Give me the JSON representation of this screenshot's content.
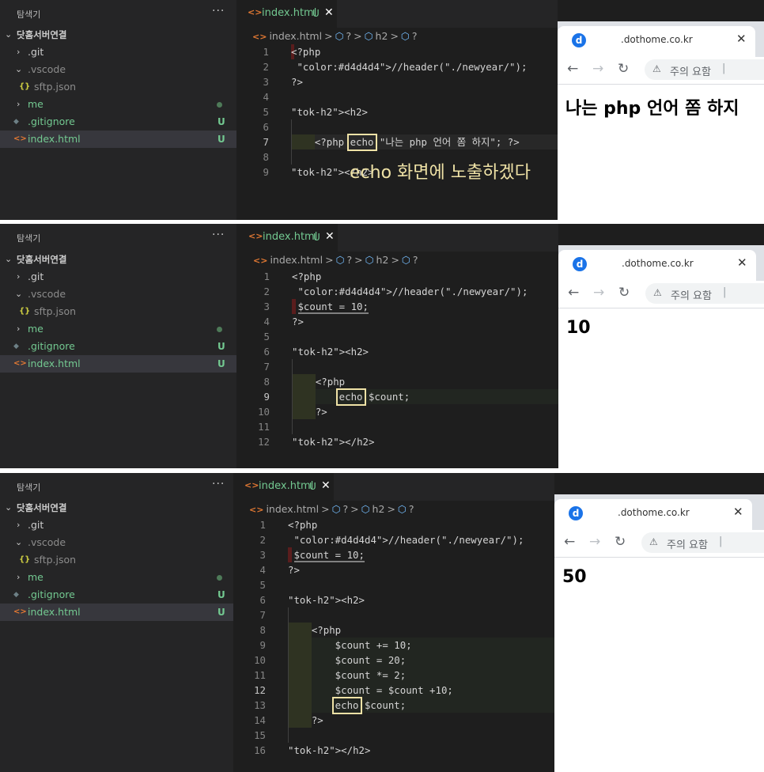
{
  "sidebar": {
    "title": "탐색기",
    "more": "···",
    "root": "닷홈서버연결",
    "items": [
      {
        "label": ".git"
      },
      {
        "label": ".vscode"
      },
      {
        "label": "sftp.json"
      },
      {
        "label": "me"
      },
      {
        "label": ".gitignore",
        "badge": "U"
      },
      {
        "label": "index.html",
        "badge": "U"
      }
    ]
  },
  "tab": {
    "icon": "<>",
    "name": "index.html",
    "status": "U",
    "close": "✕"
  },
  "breadcrumb": {
    "file": "index.html",
    "sep": ">",
    "s1": "?",
    "s2": "h2",
    "s3": "?"
  },
  "browser": {
    "favicon": "d",
    "tab_title": ".dothome.co.kr",
    "tab_close": "✕",
    "warning_icon": "⚠",
    "warning_text": "주의 요함",
    "pipe": "|",
    "back": "←",
    "forward": "→",
    "reload": "↻"
  },
  "panels": [
    {
      "lines": [
        {
          "n": "1",
          "text": "<?php"
        },
        {
          "n": "2",
          "text": " //header(\"./newyear/\");"
        },
        {
          "n": "3",
          "text": "?>"
        },
        {
          "n": "4",
          "text": ""
        },
        {
          "n": "5",
          "text": "<h2>"
        },
        {
          "n": "6",
          "text": ""
        },
        {
          "n": "7",
          "text": "    <?php echo \"나는 php 언어 쫌 하지\"; ?>"
        },
        {
          "n": "8",
          "text": ""
        },
        {
          "n": "9",
          "text": "</h2>"
        }
      ],
      "annotation": "echo 화면에 노출하겠다",
      "output": "나는 php 언어 쫌 하지"
    },
    {
      "lines": [
        {
          "n": "1",
          "text": "<?php"
        },
        {
          "n": "2",
          "text": " //header(\"./newyear/\");"
        },
        {
          "n": "3",
          "text": " $count = 10;"
        },
        {
          "n": "4",
          "text": "?>"
        },
        {
          "n": "5",
          "text": ""
        },
        {
          "n": "6",
          "text": "<h2>"
        },
        {
          "n": "7",
          "text": ""
        },
        {
          "n": "8",
          "text": "    <?php"
        },
        {
          "n": "9",
          "text": "        echo $count;"
        },
        {
          "n": "10",
          "text": "    ?>"
        },
        {
          "n": "11",
          "text": ""
        },
        {
          "n": "12",
          "text": "</h2>"
        }
      ],
      "output": "10"
    },
    {
      "lines": [
        {
          "n": "1",
          "text": "<?php"
        },
        {
          "n": "2",
          "text": " //header(\"./newyear/\");"
        },
        {
          "n": "3",
          "text": " $count = 10;"
        },
        {
          "n": "4",
          "text": "?>"
        },
        {
          "n": "5",
          "text": ""
        },
        {
          "n": "6",
          "text": "<h2>"
        },
        {
          "n": "7",
          "text": ""
        },
        {
          "n": "8",
          "text": "    <?php"
        },
        {
          "n": "9",
          "text": "        $count += 10;"
        },
        {
          "n": "10",
          "text": "        $count = 20;"
        },
        {
          "n": "11",
          "text": "        $count *= 2;"
        },
        {
          "n": "12",
          "text": "        $count = $count +10;"
        },
        {
          "n": "13",
          "text": "        echo $count;"
        },
        {
          "n": "14",
          "text": "    ?>"
        },
        {
          "n": "15",
          "text": ""
        },
        {
          "n": "16",
          "text": "</h2>"
        }
      ],
      "output": "50"
    }
  ]
}
